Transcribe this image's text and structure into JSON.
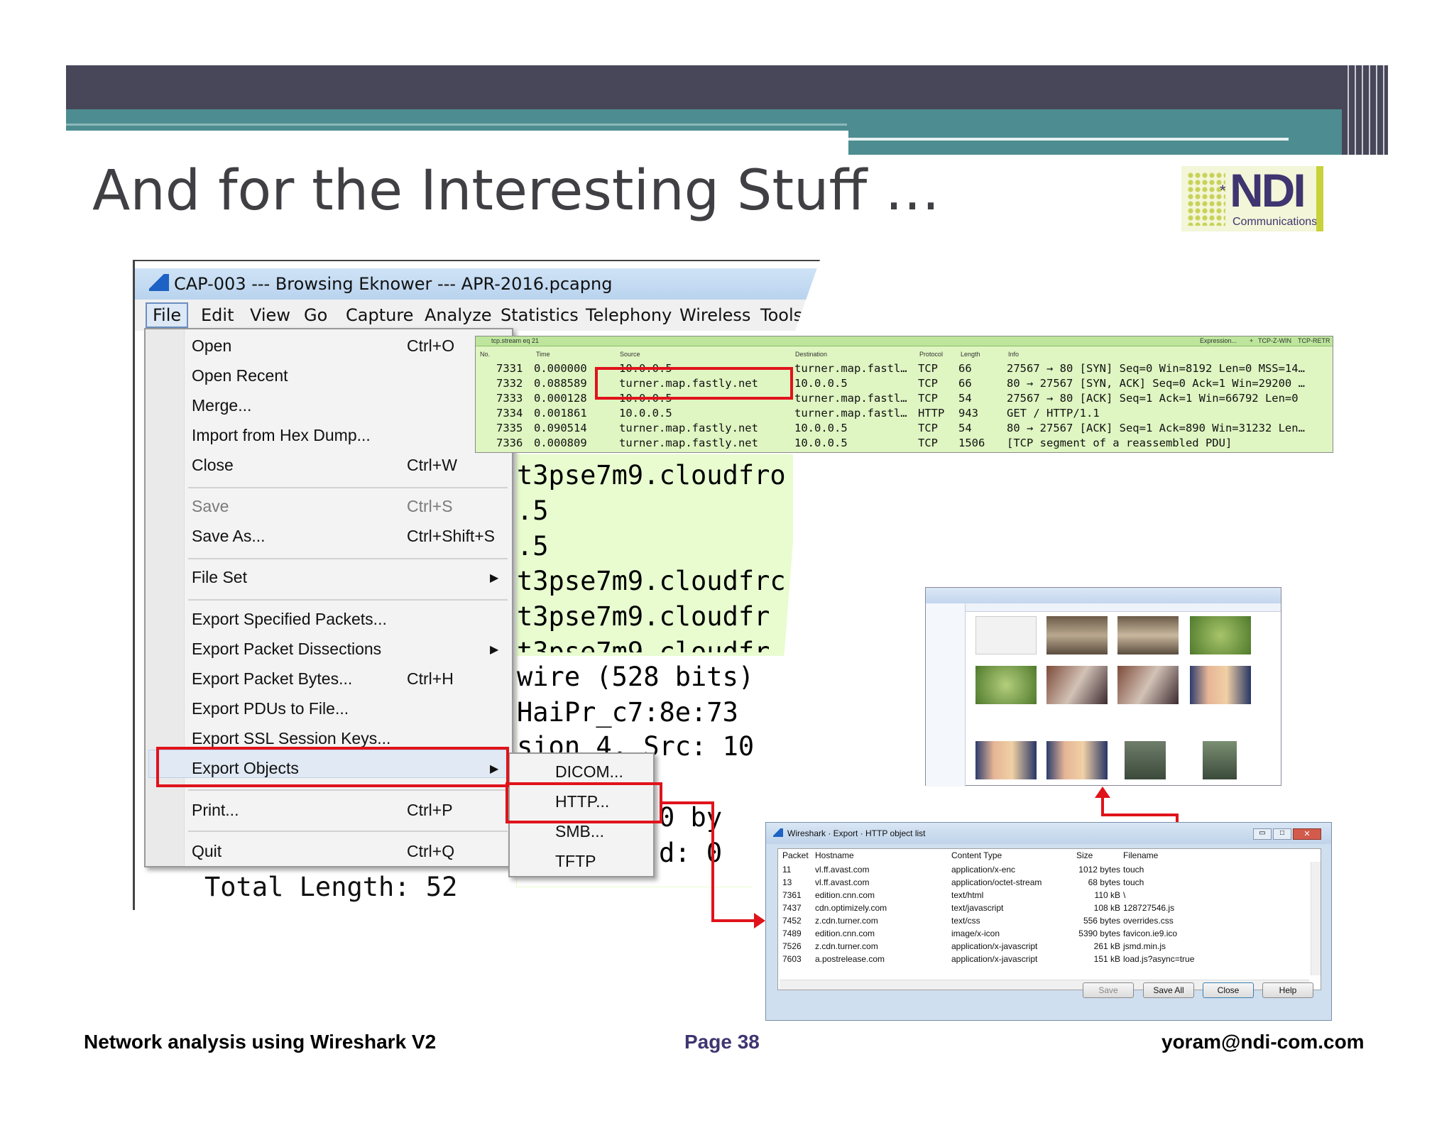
{
  "slide": {
    "title": "And for the Interesting Stuff …",
    "logo": {
      "main": "NDI",
      "sub": "Communications"
    },
    "footer": {
      "left": "Network analysis using Wireshark V2",
      "center": "Page 38",
      "right": "yoram@ndi-com.com"
    },
    "colors": {
      "band_dark": "#474759",
      "band_teal": "#4d8d91",
      "highlight_red": "#e0131b",
      "page_num": "#3f3570"
    }
  },
  "wireshark": {
    "title": "CAP-003 --- Browsing Eknower --- APR-2016.pcapng",
    "menu": [
      "File",
      "Edit",
      "View",
      "Go",
      "Capture",
      "Analyze",
      "Statistics",
      "Telephony",
      "Wireless",
      "Tools"
    ],
    "file_menu": [
      {
        "label": "Open",
        "shortcut": "Ctrl+O"
      },
      {
        "label": "Open Recent",
        "shortcut": ""
      },
      {
        "label": "Merge...",
        "shortcut": ""
      },
      {
        "label": "Import from Hex Dump...",
        "shortcut": ""
      },
      {
        "label": "Close",
        "shortcut": "Ctrl+W"
      },
      {
        "label": "Save",
        "shortcut": "Ctrl+S"
      },
      {
        "label": "Save As...",
        "shortcut": "Ctrl+Shift+S"
      },
      {
        "label": "File Set",
        "shortcut": ""
      },
      {
        "label": "Export Specified Packets...",
        "shortcut": ""
      },
      {
        "label": "Export Packet Dissections",
        "shortcut": ""
      },
      {
        "label": "Export Packet Bytes...",
        "shortcut": "Ctrl+H"
      },
      {
        "label": "Export PDUs to File...",
        "shortcut": ""
      },
      {
        "label": "Export SSL Session Keys...",
        "shortcut": ""
      },
      {
        "label": "Export Objects",
        "shortcut": ""
      },
      {
        "label": "Print...",
        "shortcut": "Ctrl+P"
      },
      {
        "label": "Quit",
        "shortcut": "Ctrl+Q"
      }
    ],
    "export_objects_submenu": [
      "DICOM...",
      "HTTP...",
      "SMB...",
      "TFTP"
    ],
    "background_lines": [
      "t3pse7m9.cloudfro",
      ".5",
      ".5",
      "t3pse7m9.cloudfrc",
      "t3pse7m9.cloudfr",
      "t3pse7m9.cloudfr",
      "wire (528 bits)",
      "HaiPr_c7:8e:73",
      "sion 4, Src: 10",
      "0 by",
      "d: 0",
      "Total Length: 52"
    ]
  },
  "packet_list": {
    "filter": "tcp.stream eq 21",
    "toolbar_right": [
      "Expression...",
      "+",
      "TCP-Z-WIN",
      "TCP-RETR"
    ],
    "columns": [
      "No.",
      "Time",
      "Source",
      "Destination",
      "Protocol",
      "Length",
      "Info"
    ],
    "rows": [
      {
        "no": "7331",
        "time": "0.000000",
        "src": "10.0.0.5",
        "dst": "turner.map.fastl…",
        "proto": "TCP",
        "len": "66",
        "info": "27567 → 80 [SYN] Seq=0 Win=8192 Len=0 MSS=14…"
      },
      {
        "no": "7332",
        "time": "0.088589",
        "src": "turner.map.fastly.net",
        "dst": "10.0.0.5",
        "proto": "TCP",
        "len": "66",
        "info": "80 → 27567 [SYN, ACK] Seq=0 Ack=1 Win=29200 …"
      },
      {
        "no": "7333",
        "time": "0.000128",
        "src": "10.0.0.5",
        "dst": "turner.map.fastl…",
        "proto": "TCP",
        "len": "54",
        "info": "27567 → 80 [ACK] Seq=1 Ack=1 Win=66792 Len=0"
      },
      {
        "no": "7334",
        "time": "0.001861",
        "src": "10.0.0.5",
        "dst": "turner.map.fastl…",
        "proto": "HTTP",
        "len": "943",
        "info": "GET / HTTP/1.1"
      },
      {
        "no": "7335",
        "time": "0.090514",
        "src": "turner.map.fastly.net",
        "dst": "10.0.0.5",
        "proto": "TCP",
        "len": "54",
        "info": "80 → 27567 [ACK] Seq=1 Ack=890 Win=31232 Len…"
      },
      {
        "no": "7336",
        "time": "0.000809",
        "src": "turner.map.fastly.net",
        "dst": "10.0.0.5",
        "proto": "TCP",
        "len": "1506",
        "info": "[TCP segment of a reassembled PDU]"
      }
    ]
  },
  "http_export": {
    "title": "Wireshark · Export · HTTP object list",
    "columns": [
      "Packet",
      "Hostname",
      "Content Type",
      "Size",
      "Filename"
    ],
    "rows": [
      {
        "packet": "11",
        "host": "vl.ff.avast.com",
        "type": "application/x-enc",
        "size": "1012 bytes",
        "file": "touch"
      },
      {
        "packet": "13",
        "host": "vl.ff.avast.com",
        "type": "application/octet-stream",
        "size": "68 bytes",
        "file": "touch"
      },
      {
        "packet": "7361",
        "host": "edition.cnn.com",
        "type": "text/html",
        "size": "110 kB",
        "file": "\\"
      },
      {
        "packet": "7437",
        "host": "cdn.optimizely.com",
        "type": "text/javascript",
        "size": "108 kB",
        "file": "128727546.js"
      },
      {
        "packet": "7452",
        "host": "z.cdn.turner.com",
        "type": "text/css",
        "size": "556 bytes",
        "file": "overrides.css"
      },
      {
        "packet": "7489",
        "host": "edition.cnn.com",
        "type": "image/x-icon",
        "size": "5390 bytes",
        "file": "favicon.ie9.ico"
      },
      {
        "packet": "7526",
        "host": "z.cdn.turner.com",
        "type": "application/x-javascript",
        "size": "261 kB",
        "file": "jsmd.min.js"
      },
      {
        "packet": "7603",
        "host": "a.postrelease.com",
        "type": "application/x-javascript",
        "size": "151 kB",
        "file": "load.js?async=true"
      }
    ],
    "buttons": [
      "Save",
      "Save All",
      "Close",
      "Help"
    ]
  }
}
